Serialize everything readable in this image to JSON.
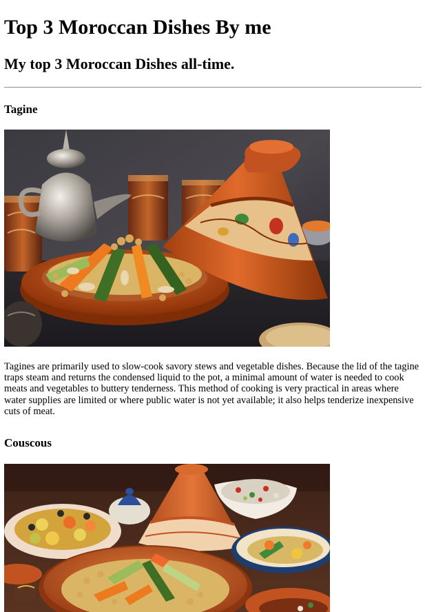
{
  "page": {
    "title": "Top 3 Moroccan Dishes By me",
    "subtitle": "My top 3 Moroccan Dishes all-time."
  },
  "dishes": [
    {
      "name": "Tagine",
      "description": "Tagines are primarily used to slow-cook savory stews and vegetable dishes. Because the lid of the tagine traps steam and returns the condensed liquid to the pot, a minimal amount of water is needed to cook meats and vegetables to buttery tenderness. This method of cooking is very practical in areas where water supplies are limited or where public water is not yet available; it also helps tenderize inexpensive cuts of meat."
    },
    {
      "name": "Couscous"
    }
  ],
  "colors": {
    "terracotta": "#c2521f",
    "dark_background": "#2d2a2c",
    "couscous_grain": "#d9b565",
    "carrot": "#ee7a1f",
    "zucchini": "#3f6e25"
  }
}
